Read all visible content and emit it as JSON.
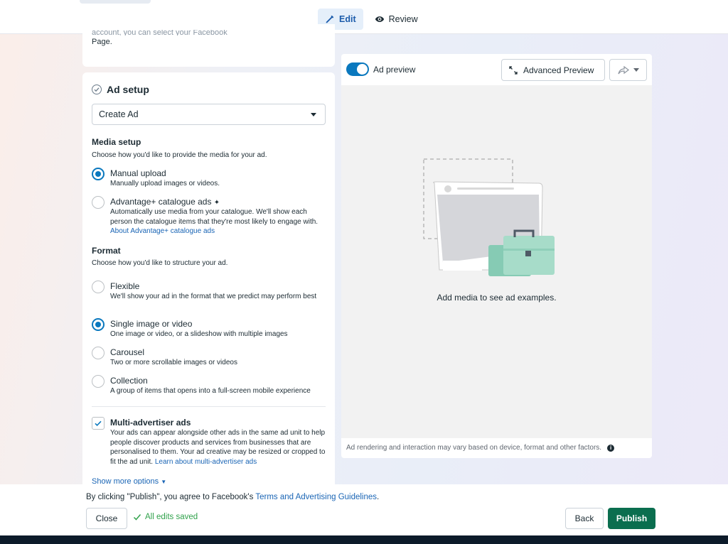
{
  "tabs": {
    "edit": "Edit",
    "review": "Review"
  },
  "left_top": {
    "page_text": "Page.",
    "faded_text": "account, you can select your Facebook"
  },
  "ad_setup": {
    "title": "Ad setup",
    "dropdown_value": "Create Ad",
    "media_setup": {
      "heading": "Media setup",
      "sub": "Choose how you'd like to provide the media for your ad.",
      "options": [
        {
          "title": "Manual upload",
          "desc": "Manually upload images or videos.",
          "selected": true
        },
        {
          "title": "Advantage+ catalogue ads",
          "desc": "Automatically use media from your catalogue. We'll show each person the catalogue items that they're most likely to engage with.",
          "link": "About Advantage+ catalogue ads",
          "selected": false
        }
      ]
    },
    "format": {
      "heading": "Format",
      "sub": "Choose how you'd like to structure your ad.",
      "options": [
        {
          "title": "Flexible",
          "desc": "We'll show your ad in the format that we predict may perform best",
          "selected": false
        },
        {
          "title": "Single image or video",
          "desc": "One image or video, or a slideshow with multiple images",
          "selected": true
        },
        {
          "title": "Carousel",
          "desc": "Two or more scrollable images or videos",
          "selected": false
        },
        {
          "title": "Collection",
          "desc": "A group of items that opens into a full-screen mobile experience",
          "selected": false
        }
      ]
    },
    "multi_advertiser": {
      "title": "Multi-advertiser ads",
      "checked": true,
      "desc": "Your ads can appear alongside other ads in the same ad unit to help people discover products and services from businesses that are personalised to them. Your ad creative may be resized or cropped to fit the ad unit.",
      "link": "Learn about multi-advertiser ads"
    },
    "show_more": "Show more options"
  },
  "preview": {
    "toggle_label": "Ad preview",
    "advanced_button": "Advanced Preview",
    "empty_message": "Add media to see ad examples.",
    "disclaimer": "Ad rendering and interaction may vary based on device, format and other factors."
  },
  "footer": {
    "terms_prefix": "By clicking \"Publish\", you agree to Facebook's ",
    "terms_link": "Terms and Advertising Guidelines",
    "terms_suffix": ".",
    "close": "Close",
    "saved_status": "All edits saved",
    "back": "Back",
    "publish": "Publish"
  },
  "colors": {
    "accent": "#0a78be",
    "publish": "#0b6e4f",
    "saved": "#31a24c",
    "link": "#1a65b5"
  }
}
